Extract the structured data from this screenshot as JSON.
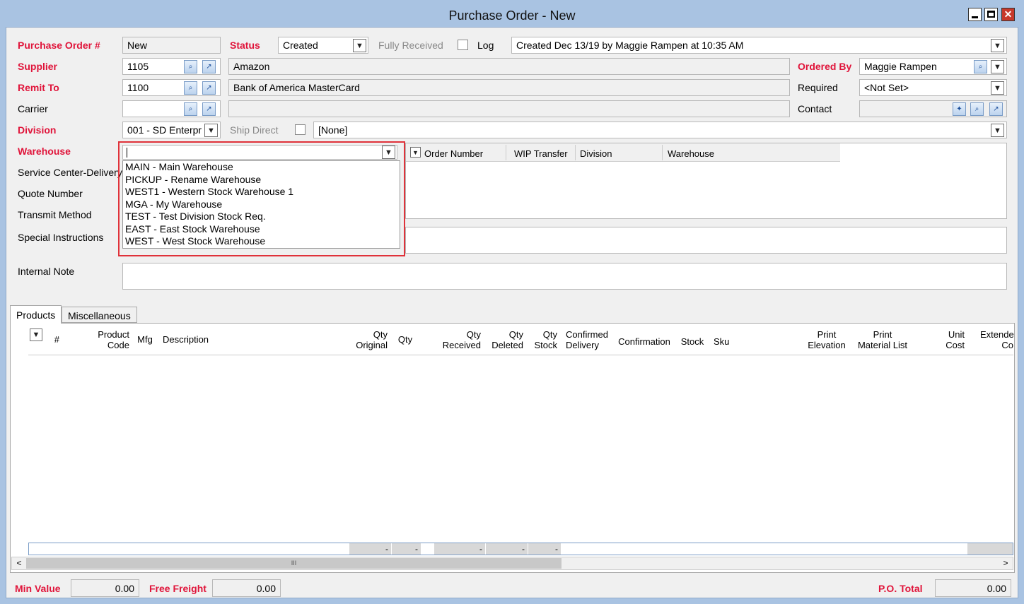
{
  "window": {
    "title": "Purchase Order - New"
  },
  "header": {
    "po_label": "Purchase Order #",
    "po_value": "New",
    "status_label": "Status",
    "status_value": "Created",
    "fully_received_label": "Fully Received",
    "log_label": "Log",
    "log_value": "Created Dec 13/19 by Maggie Rampen at 10:35 AM",
    "supplier_label": "Supplier",
    "supplier_code": "1105",
    "supplier_name": "Amazon",
    "remit_label": "Remit To",
    "remit_code": "1100",
    "remit_name": "Bank of America MasterCard",
    "carrier_label": "Carrier",
    "division_label": "Division",
    "division_value": "001 - SD Enterpr",
    "ship_direct_label": "Ship Direct",
    "ship_direct_value": "[None]",
    "ordered_by_label": "Ordered By",
    "ordered_by_value": "Maggie Rampen",
    "required_label": "Required",
    "required_value": "<Not Set>",
    "contact_label": "Contact",
    "warehouse_label": "Warehouse",
    "warehouse_value": "",
    "service_center_label": "Service Center-Delivery",
    "quote_label": "Quote Number",
    "transmit_label": "Transmit Method",
    "special_label": "Special Instructions",
    "internal_label": "Internal Note"
  },
  "warehouse_options": [
    "MAIN - Main Warehouse",
    "PICKUP - Rename Warehouse",
    "WEST1 - Western Stock Warehouse 1",
    "MGA - My Warehouse",
    "TEST - Test Division Stock Req.",
    "EAST - East Stock Warehouse",
    "WEST - West Stock Warehouse"
  ],
  "linked_grid": {
    "columns": [
      "Order Number",
      "WIP Transfer",
      "Division",
      "Warehouse"
    ]
  },
  "tabs": [
    "Products",
    "Miscellaneous"
  ],
  "products_grid": {
    "columns": [
      [
        "#"
      ],
      [
        "Product",
        "Code"
      ],
      [
        "Mfg"
      ],
      [
        "Description"
      ],
      [
        "Qty",
        "Original"
      ],
      [
        "Qty"
      ],
      [
        ""
      ],
      [
        "Qty",
        "Received"
      ],
      [
        "Qty",
        "Deleted"
      ],
      [
        "Qty",
        "Stock"
      ],
      [
        "Confirmed",
        "Delivery"
      ],
      [
        "Confirmation"
      ],
      [
        "Stock"
      ],
      [
        "Sku"
      ],
      [
        "Print",
        "Elevation"
      ],
      [
        "Print",
        "Material List"
      ],
      [
        "Unit",
        "Cost"
      ],
      [
        "Extende",
        "Co"
      ]
    ],
    "summary_marks": [
      "-",
      "-",
      "-",
      "-",
      "-"
    ]
  },
  "footer": {
    "min_value_label": "Min Value",
    "min_value": "0.00",
    "free_freight_label": "Free Freight",
    "free_freight": "0.00",
    "po_total_label": "P.O. Total",
    "po_total": "0.00"
  },
  "colors": {
    "label_red": "#e0143a",
    "highlight": "#e0323a",
    "titlebar": "#a9c3e2",
    "close": "#c7392b"
  }
}
